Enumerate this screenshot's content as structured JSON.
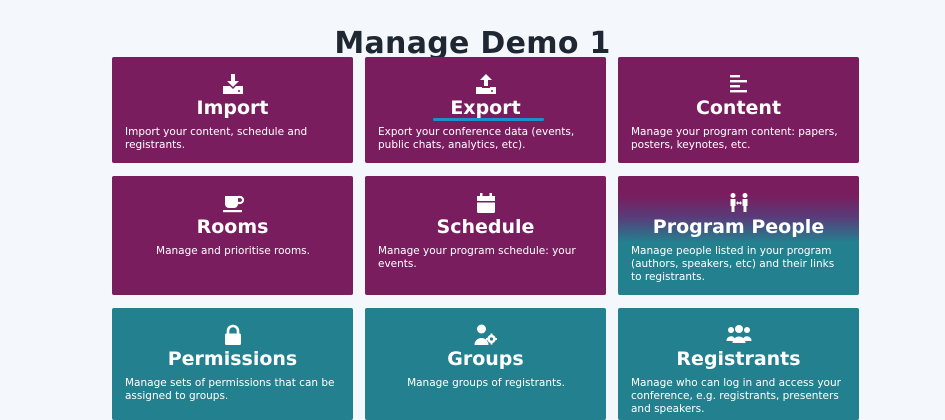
{
  "page": {
    "title": "Manage Demo 1"
  },
  "cards": [
    {
      "title": "Import",
      "icon": "download-icon",
      "description": "Import your content, schedule and registrants."
    },
    {
      "title": "Export",
      "icon": "upload-icon",
      "description": "Export your conference data (events, public chats, analytics, etc)."
    },
    {
      "title": "Content",
      "icon": "align-left-icon",
      "description": "Manage your program content: papers, posters, keynotes, etc."
    },
    {
      "title": "Rooms",
      "icon": "coffee-icon",
      "description": "Manage and prioritise rooms."
    },
    {
      "title": "Schedule",
      "icon": "calendar-icon",
      "description": "Manage your program schedule: your events."
    },
    {
      "title": "Program People",
      "icon": "people-arrows-icon",
      "description": "Manage people listed in your program (authors, speakers, etc) and their links to registrants."
    },
    {
      "title": "Permissions",
      "icon": "lock-icon",
      "description": "Manage sets of permissions that can be assigned to groups."
    },
    {
      "title": "Groups",
      "icon": "user-cog-icon",
      "description": "Manage groups of registrants."
    },
    {
      "title": "Registrants",
      "icon": "users-icon",
      "description": "Manage who can log in and access your conference, e.g. registrants, presenters and speakers."
    }
  ],
  "colors": {
    "purple": "#7a1d5e",
    "teal": "#23808f",
    "focus_underline": "#1e90c8",
    "background": "#f4f8fc"
  }
}
